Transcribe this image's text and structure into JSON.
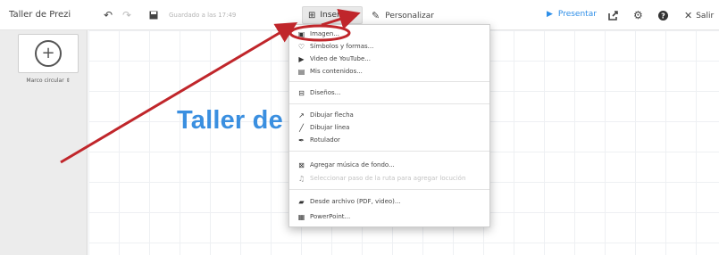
{
  "app": {
    "title": "Taller de Prezi"
  },
  "toolbar": {
    "saved_text": "Guardado a las 17:49",
    "insert_label": "Insertar",
    "personalize_label": "Personalizar",
    "present_label": "Presentar",
    "exit_label": "Salir"
  },
  "sidebar": {
    "frame_label": "Marco circular ⇕"
  },
  "canvas": {
    "title": "Taller de"
  },
  "menu": {
    "items": [
      {
        "label": "Imagen...",
        "icon": "image-icon"
      },
      {
        "label": "Símbolos y formas...",
        "icon": "shapes-icon"
      },
      {
        "label": "Video de YouTube...",
        "icon": "youtube-icon"
      },
      {
        "label": "Mis contenidos...",
        "icon": "my-content-icon"
      },
      {
        "label": "Diseños...",
        "icon": "layouts-icon"
      },
      {
        "label": "Dibujar flecha",
        "icon": "arrow-icon"
      },
      {
        "label": "Dibujar línea",
        "icon": "line-icon"
      },
      {
        "label": "Rotulador",
        "icon": "marker-icon"
      },
      {
        "label": "Agregar música de fondo...",
        "icon": "music-icon"
      },
      {
        "label": "Seleccionar paso de la ruta para agregar locución",
        "icon": "voiceover-icon",
        "disabled": true
      },
      {
        "label": "Desde archivo (PDF, video)...",
        "icon": "file-icon"
      },
      {
        "label": "PowerPoint...",
        "icon": "powerpoint-icon"
      }
    ]
  },
  "colors": {
    "accent": "#2d8ee8",
    "annotation": "#c0262b",
    "title": "#3a8fe0"
  }
}
